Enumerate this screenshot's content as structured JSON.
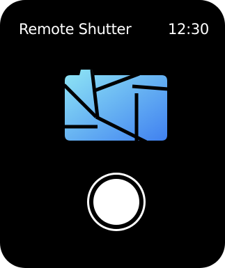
{
  "header": {
    "title": "Remote Shutter",
    "time": "12:30"
  },
  "app_icon": {
    "name": "camera-aperture-icon",
    "gradient_start": "#8fe6f5",
    "gradient_end": "#3f7ff0"
  },
  "shutter_button": {
    "name": "shutter-button",
    "color": "#ffffff"
  },
  "colors": {
    "background": "#000000",
    "text": "#ffffff"
  }
}
